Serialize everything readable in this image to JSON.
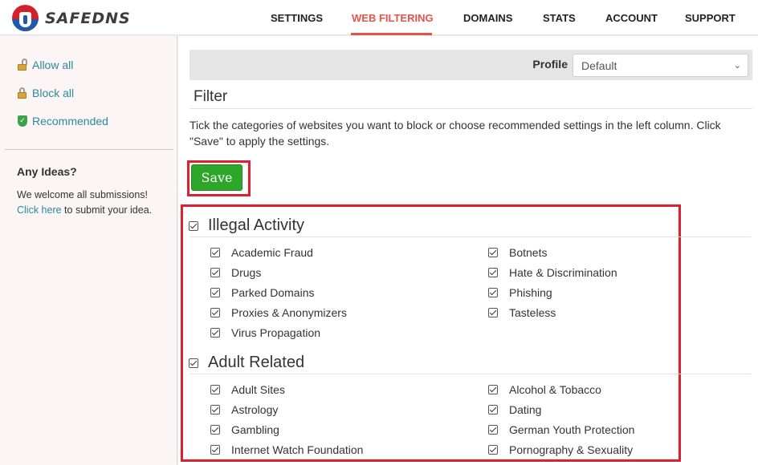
{
  "brand": {
    "name": "SAFEDNS",
    "logo_icon": "safedns-logo"
  },
  "nav": {
    "items": [
      {
        "label": "SETTINGS",
        "active": false
      },
      {
        "label": "WEB FILTERING",
        "active": true
      },
      {
        "label": "DOMAINS",
        "active": false
      },
      {
        "label": "STATS",
        "active": false
      },
      {
        "label": "ACCOUNT",
        "active": false
      },
      {
        "label": "SUPPORT",
        "active": false
      }
    ]
  },
  "sidebar": {
    "actions": [
      {
        "label": "Allow all",
        "icon": "unlocked-padlock-icon"
      },
      {
        "label": "Block all",
        "icon": "padlock-icon"
      },
      {
        "label": "Recommended",
        "icon": "shield-check-icon"
      }
    ],
    "ideas": {
      "title": "Any Ideas?",
      "text": "We welcome all submissions!",
      "link": "Click here",
      "after_link": " to submit your idea."
    }
  },
  "profile": {
    "label": "Profile",
    "selected": "Default"
  },
  "filter": {
    "title": "Filter",
    "description": "Tick the categories of websites you want to block or choose recommended settings in the left column. Click \"Save\" to apply the settings.",
    "save_label": "Save"
  },
  "groups": [
    {
      "title": "Illegal Activity",
      "checked": true,
      "left": [
        "Academic Fraud",
        "Drugs",
        "Parked Domains",
        "Proxies & Anonymizers",
        "Virus Propagation"
      ],
      "right": [
        "Botnets",
        "Hate & Discrimination",
        "Phishing",
        "Tasteless"
      ]
    },
    {
      "title": "Adult Related",
      "checked": true,
      "left": [
        "Adult Sites",
        "Astrology",
        "Gambling",
        "Internet Watch Foundation"
      ],
      "right": [
        "Alcohol & Tobacco",
        "Dating",
        "German Youth Protection",
        "Pornography & Sexuality"
      ]
    }
  ],
  "colors": {
    "accent": "#e8524a",
    "link": "#2a8a9a",
    "save": "#2ea62a",
    "highlight": "#e0202f"
  }
}
